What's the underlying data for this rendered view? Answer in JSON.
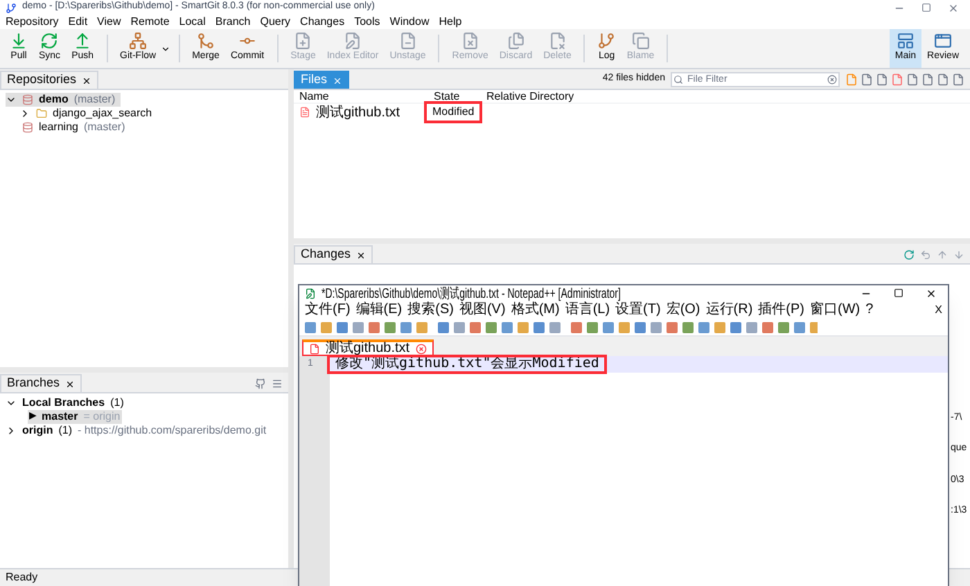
{
  "window": {
    "title": "demo - [D:\\Spareribs\\Github\\demo] - SmartGit 8.0.3 (for non-commercial use only)"
  },
  "menu": [
    "Repository",
    "Edit",
    "View",
    "Remote",
    "Local",
    "Branch",
    "Query",
    "Changes",
    "Tools",
    "Window",
    "Help"
  ],
  "toolbar": [
    [
      {
        "label": "Pull",
        "disabled": false
      },
      {
        "label": "Sync",
        "disabled": false
      },
      {
        "label": "Push",
        "disabled": false
      }
    ],
    [
      {
        "label": "Git-Flow",
        "disabled": false,
        "kind": "dropdown"
      }
    ],
    [
      {
        "label": "Merge",
        "disabled": false
      },
      {
        "label": "Commit",
        "disabled": false
      }
    ],
    [
      {
        "label": "Stage",
        "disabled": true
      },
      {
        "label": "Index Editor",
        "disabled": true
      },
      {
        "label": "Unstage",
        "disabled": true
      }
    ],
    [
      {
        "label": "Remove",
        "disabled": true
      },
      {
        "label": "Discard",
        "disabled": true
      },
      {
        "label": "Delete",
        "disabled": true
      }
    ],
    [
      {
        "label": "Log",
        "disabled": false
      },
      {
        "label": "Blame",
        "disabled": true
      }
    ]
  ],
  "perspectives": [
    {
      "label": "Main",
      "selected": true
    },
    {
      "label": "Review",
      "selected": false
    }
  ],
  "repositories": {
    "tab": "Repositories",
    "items": [
      {
        "name": "demo",
        "branch": "(master)",
        "selected": true,
        "expanded": true,
        "children": [
          {
            "name": "django_ajax_search",
            "expanded": false
          }
        ]
      },
      {
        "name": "learning",
        "branch": "(master)",
        "selected": false
      }
    ]
  },
  "files": {
    "tab": "Files",
    "hidden_count": "42 files hidden",
    "filter": {
      "placeholder": "File Filter"
    },
    "columns": [
      "Name",
      "State",
      "Relative Directory"
    ],
    "rows": [
      {
        "name": "测试github.txt",
        "state": "Modified",
        "annotated": true
      }
    ]
  },
  "changes": {
    "tab": "Changes"
  },
  "branches": {
    "tab": "Branches",
    "items": [
      {
        "name": "Local Branches",
        "count": "(1)",
        "expanded": true,
        "children": [
          {
            "marker": "▶",
            "name": "master",
            "tracking": "= origin",
            "selected": true
          }
        ]
      },
      {
        "name": "origin",
        "count": "(1)",
        "url": "- https://github.com/spareribs/demo.git",
        "expanded": false
      }
    ]
  },
  "background_fragments": [
    "-7\\",
    "que",
    "0\\3",
    ":1\\3"
  ],
  "status_bar": "Ready",
  "notepad": {
    "title": "*D:\\Spareribs\\Github\\demo\\测试github.txt - Notepad++ [Administrator]",
    "menu": [
      "文件(F)",
      "编辑(E)",
      "搜索(S)",
      "视图(V)",
      "格式(M)",
      "语言(L)",
      "设置(T)",
      "宏(O)",
      "运行(R)",
      "插件(P)",
      "窗口(W)",
      "?"
    ],
    "close_doc": "X",
    "tab": {
      "label": "测试github.txt",
      "modified": true,
      "annotated": true
    },
    "lines": [
      {
        "number": "1",
        "text": "修改\"测试github.txt\"会显示Modified",
        "current": true,
        "annotated": true
      }
    ]
  }
}
